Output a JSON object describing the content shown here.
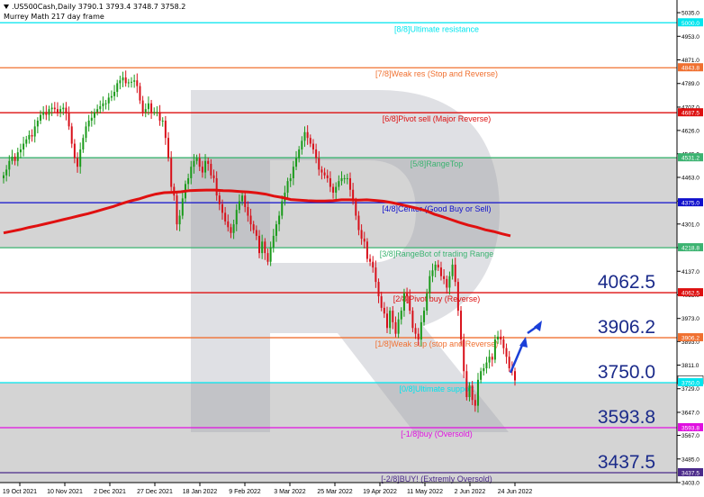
{
  "header": {
    "symbol_line": ".US500Cash,Daily  3790.1 3793.4 3748.7 3758.2",
    "subtitle": "Murrey Math 217 day frame"
  },
  "colors": {
    "background": "#ffffff",
    "bull": "#1a9a1a",
    "bear": "#d8101a",
    "ma": "#e01010",
    "zone_fill": "#d4d4d4",
    "arrow": "#1a3fd8",
    "watermark": "#9aa0aa"
  },
  "chart_data": {
    "type": "line",
    "title": "",
    "ylim": [
      3403.0,
      5079.0
    ],
    "y_ticks": [
      5035.0,
      4953.0,
      4871.0,
      4789.0,
      4707.0,
      4626.0,
      4545.0,
      4463.0,
      4381.0,
      4301.0,
      4219.0,
      4137.0,
      4055.0,
      3973.0,
      3893.0,
      3811.0,
      3729.0,
      3647.0,
      3567.0,
      3485.0,
      3403.0
    ],
    "y_tick_labels": [
      "5035.0",
      "4953.0",
      "4871.0",
      "4789.0",
      "4707.0",
      "4626.0",
      "4545.0",
      "4463.0",
      "4381.0",
      "4301.0",
      "4219.0",
      "4137.0",
      "4055.0",
      "3973.0",
      "3893.0",
      "3811.0",
      "3729.0",
      "3647.0",
      "3567.0",
      "3485.0",
      "3403.0"
    ],
    "x_labels": [
      "19 Oct 2021",
      "10 Nov 2021",
      "2 Dec 2021",
      "27 Dec 2021",
      "18 Jan 2022",
      "9 Feb 2022",
      "3 Mar 2022",
      "25 Mar 2022",
      "19 Apr 2022",
      "11 May 2022",
      "2 Jun 2022",
      "24 Jun 2022"
    ],
    "murrey_levels": [
      {
        "label": "[8/8]Ultimate resistance",
        "value": 5000.0,
        "value_label": "5000.0",
        "color": "#00e5ee"
      },
      {
        "label": "[7/8]Weak res (Stop and Reverse)",
        "value": 4843.8,
        "value_label": "4843.8",
        "color": "#f07030"
      },
      {
        "label": "[6/8]Pivot sell (Major Reverse)",
        "value": 4687.5,
        "value_label": "4687.5",
        "color": "#dd1010"
      },
      {
        "label": "[5/8]RangeTop",
        "value": 4531.2,
        "value_label": "4531.2",
        "color": "#3cb371"
      },
      {
        "label": "[4/8]Center (Good Buy or Sell)",
        "value": 4375.0,
        "value_label": "4375.0",
        "color": "#1010cc"
      },
      {
        "label": "[3/8]RangeBot of trading Range",
        "value": 4218.8,
        "value_label": "4218.8",
        "color": "#3cb371"
      },
      {
        "label": "[2/8]Pivot buy (Reverse)",
        "value": 4062.5,
        "value_label": "4062.5",
        "color": "#dd1010"
      },
      {
        "label": "[1/8]Weak sup (stop and Reverse)",
        "value": 3906.2,
        "value_label": "3906.2",
        "color": "#f07030"
      },
      {
        "label": "[0/8]Ultimate support",
        "value": 3750.0,
        "value_label": "3750.0",
        "color": "#00e5ee"
      },
      {
        "label": "[-1/8]buy (Oversold)",
        "value": 3593.8,
        "value_label": "3593.8",
        "color": "#e010e0"
      },
      {
        "label": "[-2/8]BUY! (Extremly Oversold)",
        "value": 3437.5,
        "value_label": "3437.5",
        "color": "#4b2a8a"
      }
    ],
    "big_labels": [
      "4062.5",
      "3906.2",
      "3750.0",
      "3593.8",
      "3437.5"
    ],
    "current_price": {
      "value": 3758.2,
      "label": "3758.2"
    },
    "bands": [
      {
        "from": 4218.8,
        "to": 4531.2
      },
      {
        "from": 3403.0,
        "to": 3750.0
      }
    ],
    "close_series": [
      4470,
      4490,
      4520,
      4535,
      4520,
      4550,
      4560,
      4580,
      4595,
      4610,
      4605,
      4640,
      4660,
      4680,
      4690,
      4680,
      4700,
      4705,
      4700,
      4690,
      4700,
      4705,
      4685,
      4640,
      4580,
      4530,
      4500,
      4560,
      4600,
      4640,
      4660,
      4670,
      4690,
      4700,
      4710,
      4720,
      4720,
      4740,
      4745,
      4760,
      4790,
      4800,
      4810,
      4790,
      4793,
      4795,
      4800,
      4780,
      4730,
      4690,
      4700,
      4720,
      4690,
      4690,
      4690,
      4660,
      4660,
      4600,
      4530,
      4430,
      4400,
      4300,
      4330,
      4390,
      4440,
      4460,
      4500,
      4520,
      4530,
      4500,
      4480,
      4520,
      4510,
      4470,
      4460,
      4400,
      4370,
      4340,
      4310,
      4290,
      4270,
      4300,
      4350,
      4380,
      4400,
      4360,
      4330,
      4300,
      4280,
      4260,
      4200,
      4240,
      4200,
      4170,
      4220,
      4260,
      4300,
      4330,
      4380,
      4410,
      4450,
      4460,
      4500,
      4530,
      4560,
      4590,
      4620,
      4600,
      4580,
      4560,
      4530,
      4490,
      4480,
      4470,
      4460,
      4430,
      4410,
      4430,
      4450,
      4460,
      4460,
      4460,
      4420,
      4380,
      4330,
      4280,
      4250,
      4240,
      4180,
      4170,
      4150,
      4100,
      4050,
      4010,
      3990,
      3940,
      4000,
      3960,
      3920,
      3970,
      4000,
      4060,
      4050,
      4000,
      3940,
      3920,
      3900,
      3960,
      4000,
      4060,
      4120,
      4140,
      4160,
      4150,
      4120,
      4110,
      4080,
      4120,
      4160,
      4100,
      4000,
      3900,
      3790,
      3700,
      3740,
      3690,
      3670,
      3760,
      3790,
      3800,
      3820,
      3840,
      3830,
      3900,
      3910,
      3900,
      3870,
      3840,
      3800,
      3790,
      3758
    ],
    "ma_series": [
      4270,
      4276,
      4282,
      4289,
      4295,
      4302,
      4309,
      4316,
      4323,
      4330,
      4337,
      4345,
      4354,
      4362,
      4372,
      4381,
      4388,
      4397,
      4405,
      4410,
      4411,
      4413,
      4417,
      4418,
      4419,
      4419,
      4417,
      4416,
      4414,
      4412,
      4409,
      4405,
      4398,
      4393,
      4386,
      4384,
      4382,
      4381,
      4381,
      4382,
      4385,
      4385,
      4384,
      4385,
      4383,
      4380,
      4375,
      4369,
      4362,
      4355,
      4347,
      4335,
      4326,
      4316,
      4306,
      4297,
      4290,
      4281,
      4275,
      4267,
      4260
    ]
  }
}
